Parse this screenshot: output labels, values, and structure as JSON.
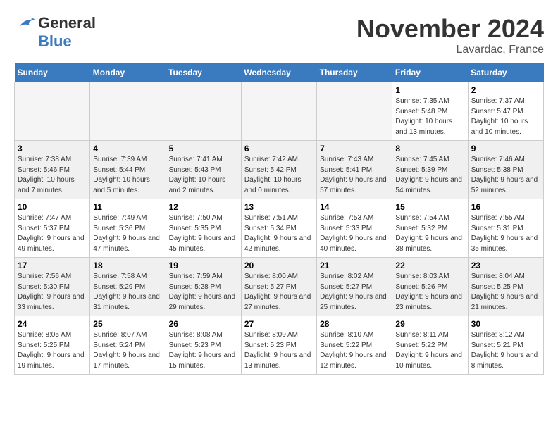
{
  "header": {
    "logo_general": "General",
    "logo_blue": "Blue",
    "month": "November 2024",
    "location": "Lavardac, France"
  },
  "weekdays": [
    "Sunday",
    "Monday",
    "Tuesday",
    "Wednesday",
    "Thursday",
    "Friday",
    "Saturday"
  ],
  "weeks": [
    [
      {
        "day": "",
        "info": ""
      },
      {
        "day": "",
        "info": ""
      },
      {
        "day": "",
        "info": ""
      },
      {
        "day": "",
        "info": ""
      },
      {
        "day": "",
        "info": ""
      },
      {
        "day": "1",
        "info": "Sunrise: 7:35 AM\nSunset: 5:48 PM\nDaylight: 10 hours and 13 minutes."
      },
      {
        "day": "2",
        "info": "Sunrise: 7:37 AM\nSunset: 5:47 PM\nDaylight: 10 hours and 10 minutes."
      }
    ],
    [
      {
        "day": "3",
        "info": "Sunrise: 7:38 AM\nSunset: 5:46 PM\nDaylight: 10 hours and 7 minutes."
      },
      {
        "day": "4",
        "info": "Sunrise: 7:39 AM\nSunset: 5:44 PM\nDaylight: 10 hours and 5 minutes."
      },
      {
        "day": "5",
        "info": "Sunrise: 7:41 AM\nSunset: 5:43 PM\nDaylight: 10 hours and 2 minutes."
      },
      {
        "day": "6",
        "info": "Sunrise: 7:42 AM\nSunset: 5:42 PM\nDaylight: 10 hours and 0 minutes."
      },
      {
        "day": "7",
        "info": "Sunrise: 7:43 AM\nSunset: 5:41 PM\nDaylight: 9 hours and 57 minutes."
      },
      {
        "day": "8",
        "info": "Sunrise: 7:45 AM\nSunset: 5:39 PM\nDaylight: 9 hours and 54 minutes."
      },
      {
        "day": "9",
        "info": "Sunrise: 7:46 AM\nSunset: 5:38 PM\nDaylight: 9 hours and 52 minutes."
      }
    ],
    [
      {
        "day": "10",
        "info": "Sunrise: 7:47 AM\nSunset: 5:37 PM\nDaylight: 9 hours and 49 minutes."
      },
      {
        "day": "11",
        "info": "Sunrise: 7:49 AM\nSunset: 5:36 PM\nDaylight: 9 hours and 47 minutes."
      },
      {
        "day": "12",
        "info": "Sunrise: 7:50 AM\nSunset: 5:35 PM\nDaylight: 9 hours and 45 minutes."
      },
      {
        "day": "13",
        "info": "Sunrise: 7:51 AM\nSunset: 5:34 PM\nDaylight: 9 hours and 42 minutes."
      },
      {
        "day": "14",
        "info": "Sunrise: 7:53 AM\nSunset: 5:33 PM\nDaylight: 9 hours and 40 minutes."
      },
      {
        "day": "15",
        "info": "Sunrise: 7:54 AM\nSunset: 5:32 PM\nDaylight: 9 hours and 38 minutes."
      },
      {
        "day": "16",
        "info": "Sunrise: 7:55 AM\nSunset: 5:31 PM\nDaylight: 9 hours and 35 minutes."
      }
    ],
    [
      {
        "day": "17",
        "info": "Sunrise: 7:56 AM\nSunset: 5:30 PM\nDaylight: 9 hours and 33 minutes."
      },
      {
        "day": "18",
        "info": "Sunrise: 7:58 AM\nSunset: 5:29 PM\nDaylight: 9 hours and 31 minutes."
      },
      {
        "day": "19",
        "info": "Sunrise: 7:59 AM\nSunset: 5:28 PM\nDaylight: 9 hours and 29 minutes."
      },
      {
        "day": "20",
        "info": "Sunrise: 8:00 AM\nSunset: 5:27 PM\nDaylight: 9 hours and 27 minutes."
      },
      {
        "day": "21",
        "info": "Sunrise: 8:02 AM\nSunset: 5:27 PM\nDaylight: 9 hours and 25 minutes."
      },
      {
        "day": "22",
        "info": "Sunrise: 8:03 AM\nSunset: 5:26 PM\nDaylight: 9 hours and 23 minutes."
      },
      {
        "day": "23",
        "info": "Sunrise: 8:04 AM\nSunset: 5:25 PM\nDaylight: 9 hours and 21 minutes."
      }
    ],
    [
      {
        "day": "24",
        "info": "Sunrise: 8:05 AM\nSunset: 5:25 PM\nDaylight: 9 hours and 19 minutes."
      },
      {
        "day": "25",
        "info": "Sunrise: 8:07 AM\nSunset: 5:24 PM\nDaylight: 9 hours and 17 minutes."
      },
      {
        "day": "26",
        "info": "Sunrise: 8:08 AM\nSunset: 5:23 PM\nDaylight: 9 hours and 15 minutes."
      },
      {
        "day": "27",
        "info": "Sunrise: 8:09 AM\nSunset: 5:23 PM\nDaylight: 9 hours and 13 minutes."
      },
      {
        "day": "28",
        "info": "Sunrise: 8:10 AM\nSunset: 5:22 PM\nDaylight: 9 hours and 12 minutes."
      },
      {
        "day": "29",
        "info": "Sunrise: 8:11 AM\nSunset: 5:22 PM\nDaylight: 9 hours and 10 minutes."
      },
      {
        "day": "30",
        "info": "Sunrise: 8:12 AM\nSunset: 5:21 PM\nDaylight: 9 hours and 8 minutes."
      }
    ]
  ]
}
